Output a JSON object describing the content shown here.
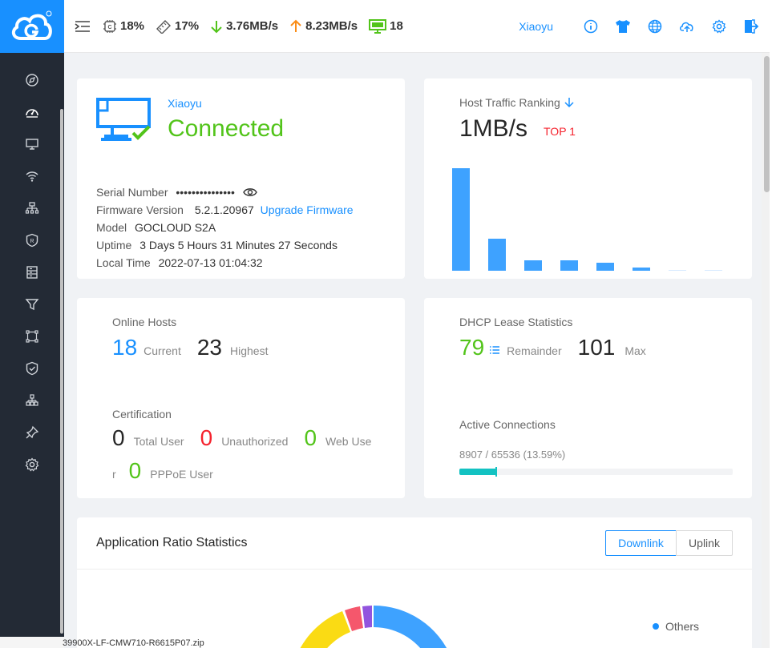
{
  "topbar": {
    "cpu": "18%",
    "memory": "17%",
    "download": "3.76MB/s",
    "upload": "8.23MB/s",
    "hosts": "18",
    "user": "Xiaoyu"
  },
  "status_card": {
    "name": "Xiaoyu",
    "status": "Connected",
    "serial_label": "Serial Number",
    "serial_value": "•••••••••••••••",
    "firmware_label": "Firmware Version",
    "firmware_value": "5.2.1.20967",
    "upgrade_link": "Upgrade Firmware",
    "model_label": "Model",
    "model_value": "GOCLOUD S2A",
    "uptime_label": "Uptime",
    "uptime_value": "3 Days 5 Hours 31 Minutes 27 Seconds",
    "localtime_label": "Local Time",
    "localtime_value": "2022-07-13 01:04:32"
  },
  "traffic_card": {
    "title": "Host Traffic Ranking",
    "value": "1MB/s",
    "badge": "TOP 1"
  },
  "chart_data": {
    "type": "bar",
    "categories": [
      "1",
      "2",
      "3",
      "4",
      "5",
      "6",
      "7",
      "8"
    ],
    "values": [
      100,
      31,
      10.5,
      10,
      7.5,
      3,
      0.6,
      0.3
    ],
    "ylim": [
      0,
      100
    ]
  },
  "hosts_card": {
    "title": "Online Hosts",
    "current_value": "18",
    "current_label": "Current",
    "highest_value": "23",
    "highest_label": "Highest",
    "cert_title": "Certification",
    "total_value": "0",
    "total_label": "Total User",
    "unauth_value": "0",
    "unauth_label": "Unauthorized",
    "web_value": "0",
    "web_label": "Web Use",
    "web_label_wrap": "r",
    "pppoe_value": "0",
    "pppoe_label": "PPPoE User"
  },
  "dhcp_card": {
    "title": "DHCP Lease Statistics",
    "remainder_value": "79",
    "remainder_label": "Remainder",
    "max_value": "101",
    "max_label": "Max",
    "active_title": "Active Connections",
    "active_text": "8907 / 65536 (13.59%)",
    "active_fraction": 0.1359
  },
  "app_card": {
    "title": "Application Ratio Statistics",
    "downlink": "Downlink",
    "uplink": "Uplink",
    "legend_others": "Others"
  },
  "taskbar": {
    "file_text": "39900X-LF-CMW710-R6615P07.zip"
  },
  "colors": {
    "brand": "#1890ff",
    "sidebar": "#232a35",
    "green": "#52c41a",
    "red": "#f5222d",
    "bar": "#3ea2ff",
    "progress": "#13c2c2"
  }
}
